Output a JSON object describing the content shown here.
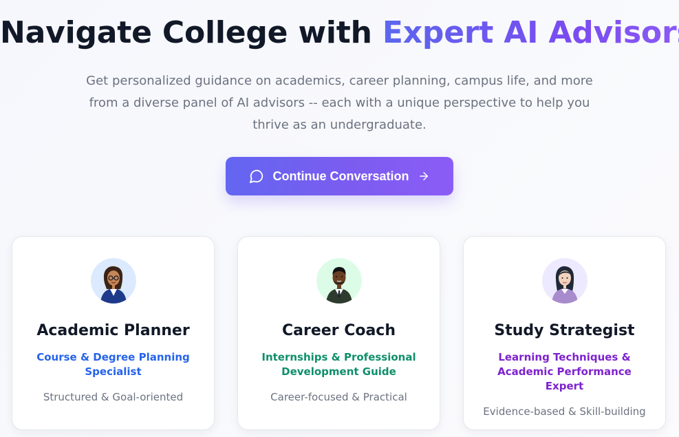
{
  "hero": {
    "title_main": "Navigate College with ",
    "title_accent": "Expert AI Advisors",
    "subtitle": "Get personalized guidance on academics, career planning, campus life, and more from a diverse panel of AI advisors -- each with a unique perspective to help you thrive as an undergraduate.",
    "cta_label": "Continue Conversation",
    "cta_icon": "chat-bubble-icon",
    "cta_arrow_icon": "arrow-right-icon"
  },
  "colors": {
    "accent_start": "#5b67ee",
    "accent_end": "#8b5cf6",
    "academic_role": "#2563eb",
    "career_role": "#0f8f6a",
    "study_role": "#7e22ce"
  },
  "advisors": [
    {
      "title": "Academic Planner",
      "role": "Course & Degree Planning Specialist",
      "trait": "Structured & Goal-oriented",
      "avatar_icon": "female-advisor-avatar-icon"
    },
    {
      "title": "Career Coach",
      "role": "Internships & Professional Development Guide",
      "trait": "Career-focused & Practical",
      "avatar_icon": "male-advisor-avatar-icon"
    },
    {
      "title": "Study Strategist",
      "role": "Learning Techniques & Academic Performance Expert",
      "trait": "Evidence-based & Skill-building",
      "avatar_icon": "female-strategist-avatar-icon"
    }
  ]
}
